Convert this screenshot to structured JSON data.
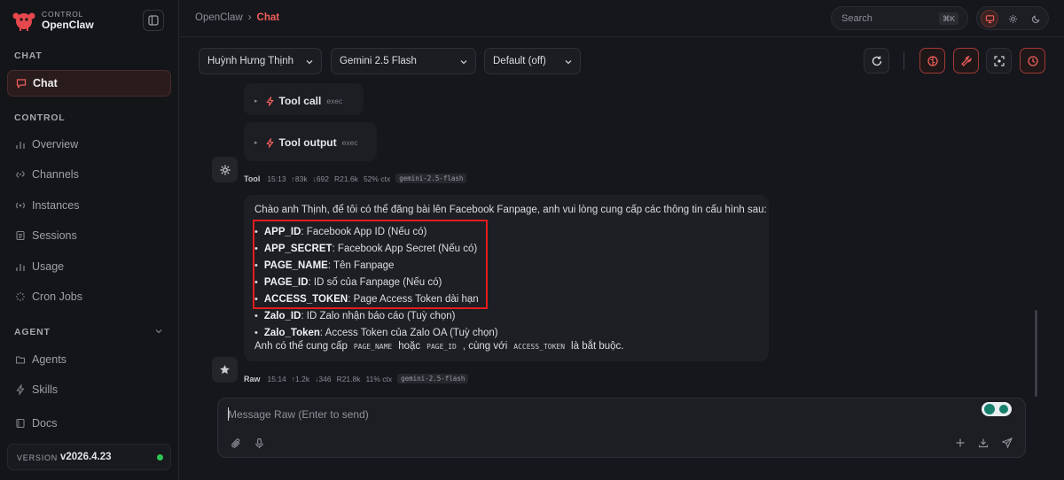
{
  "brand": {
    "small": "CONTROL",
    "name": "OpenClaw"
  },
  "sidebar": {
    "sections": [
      {
        "label": "CHAT"
      },
      {
        "label": "CONTROL"
      },
      {
        "label": "AGENT"
      }
    ],
    "items": [
      {
        "label": "Chat",
        "icon": "chat-bubble-icon",
        "active": true
      },
      {
        "label": "Overview",
        "icon": "bar-chart-icon"
      },
      {
        "label": "Channels",
        "icon": "link-icon"
      },
      {
        "label": "Instances",
        "icon": "broadcast-icon"
      },
      {
        "label": "Sessions",
        "icon": "document-icon"
      },
      {
        "label": "Usage",
        "icon": "bar-chart-icon"
      },
      {
        "label": "Cron Jobs",
        "icon": "loader-icon"
      },
      {
        "label": "Agents",
        "icon": "folder-icon"
      },
      {
        "label": "Skills",
        "icon": "bolt-icon"
      },
      {
        "label": "Docs",
        "icon": "book-icon"
      }
    ],
    "version_label": "VERSION",
    "version": "v2026.4.23",
    "status_color": "#2dc653"
  },
  "header": {
    "breadcrumb_root": "OpenClaw",
    "breadcrumb_sep": "›",
    "breadcrumb_current": "Chat",
    "search_placeholder": "Search",
    "search_shortcut": "⌘K",
    "accent": "#f25f5c"
  },
  "toolbar": {
    "user_select": "Huỳnh Hưng Thịnh",
    "model_select": "Gemini 2.5 Flash",
    "mode_select": "Default (off)"
  },
  "messages": {
    "tool_call": {
      "label": "Tool call",
      "tag": "exec"
    },
    "tool_output": {
      "label": "Tool output",
      "tag": "exec"
    },
    "tool_meta": {
      "who": "Tool",
      "time": "15:13",
      "up": "↑83k",
      "down": "↓692",
      "r": "R21.6k",
      "ctx": "52% ctx",
      "model": "gemini-2.5-flash"
    },
    "reply": {
      "intro": "Chào anh Thịnh, để tôi có thể đăng bài lên Facebook Fanpage, anh vui lòng cung cấp các thông tin cấu hình sau:",
      "items": [
        {
          "key": "APP_ID",
          "desc": ": Facebook App ID (Nếu có)"
        },
        {
          "key": "APP_SECRET",
          "desc": ": Facebook App Secret (Nếu có)"
        },
        {
          "key": "PAGE_NAME",
          "desc": ": Tên Fanpage"
        },
        {
          "key": "PAGE_ID",
          "desc": ": ID số của Fanpage (Nếu có)"
        },
        {
          "key": "ACCESS_TOKEN",
          "desc": ": Page Access Token dài hạn"
        },
        {
          "key": "Zalo_ID",
          "desc": ": ID Zalo nhận báo cáo (Tuỳ chọn)"
        },
        {
          "key": "Zalo_Token",
          "desc": ": Access Token của Zalo OA (Tuỳ chọn)"
        }
      ],
      "outro_a": "Anh có thể cung cấp",
      "code1": "PAGE_NAME",
      "outro_b": "hoặc",
      "code2": "PAGE_ID",
      "outro_c": ", cùng với",
      "code3": "ACCESS_TOKEN",
      "outro_d": "là bắt buộc."
    },
    "raw_meta": {
      "who": "Raw",
      "time": "15:14",
      "up": "↑1.2k",
      "down": "↓346",
      "r": "R21.8k",
      "ctx": "11% ctx",
      "model": "gemini-2.5-flash"
    }
  },
  "composer": {
    "placeholder": "Message Raw (Enter to send)"
  }
}
